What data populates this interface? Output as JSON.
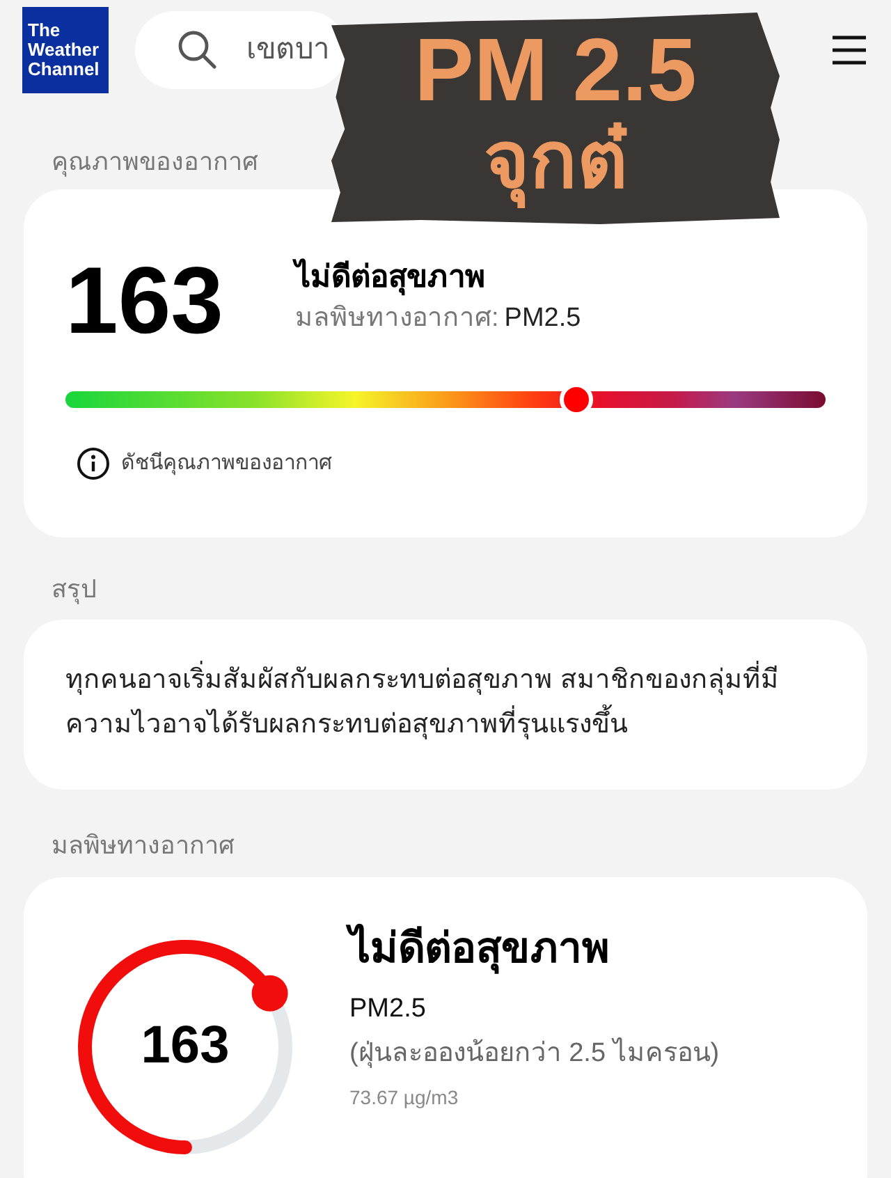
{
  "header": {
    "logo": [
      "The",
      "Weather",
      "Channel"
    ],
    "search": {
      "value": "เขตบา"
    }
  },
  "sticker": {
    "line_1": "PM 2.5",
    "line_2": "จุกต๋"
  },
  "air_quality": {
    "heading": "คุณภาพของอากาศ",
    "index": "163",
    "category": "ไม่ดีต่อสุขภาพ",
    "pollutant_label": "มลพิษทางอากาศ:",
    "pollutant": "PM2.5",
    "level": 0.673,
    "info": "ดัชนีคุณภาพของอากาศ"
  },
  "summary": {
    "heading": "สรุป",
    "text": "ทุกคนอาจเริ่มสัมผัสกับผลกระทบต่อสุขภาพ สมาชิกของกลุ่มที่มีความไวอาจได้รับผลกระทบต่อสุขภาพที่รุนแรงขึ้น"
  },
  "pollutant": {
    "heading": "มลพิษทางอากาศ",
    "index": "163",
    "category": "ไม่ดีต่อสุขภาพ",
    "name": "PM2.5",
    "description": "(ฝุ่นละอองน้อยกว่า 2.5 ไมครอน)",
    "concentration": "73.67 µg/m3"
  }
}
